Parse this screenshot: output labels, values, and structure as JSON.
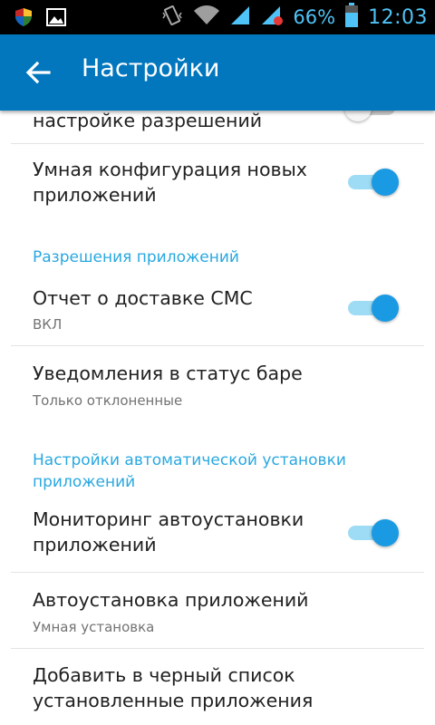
{
  "status_bar": {
    "battery_percent": "66%",
    "time": "12:03",
    "accent_color": "#4fc3f7",
    "icons": [
      "shield-icon",
      "image-icon",
      "vibrate-icon",
      "wifi-icon",
      "signal-icon",
      "signal-2-icon",
      "battery-icon"
    ]
  },
  "app_bar": {
    "title": "Настройки",
    "color": "#0277bd"
  },
  "settings": {
    "partial_item": {
      "title": "настройке разрешений",
      "enabled": false
    },
    "smart_config": {
      "title": "Умная конфигурация новых приложений",
      "enabled": true
    },
    "section_permissions": "Разрешения приложений",
    "sms_report": {
      "title": "Отчет о доставке СМС",
      "summary": "ВКЛ",
      "enabled": true
    },
    "statusbar_notif": {
      "title": "Уведомления в статус баре",
      "summary": "Только отклоненные"
    },
    "section_autoinstall": "Настройки автоматической установки приложений",
    "autoinstall_monitor": {
      "title": "Мониторинг автоустановки приложений",
      "enabled": true
    },
    "autoinstall": {
      "title": "Автоустановка приложений",
      "summary": "Умная установка"
    },
    "blacklist": {
      "title": "Добавить в черный список установленные приложения"
    }
  }
}
